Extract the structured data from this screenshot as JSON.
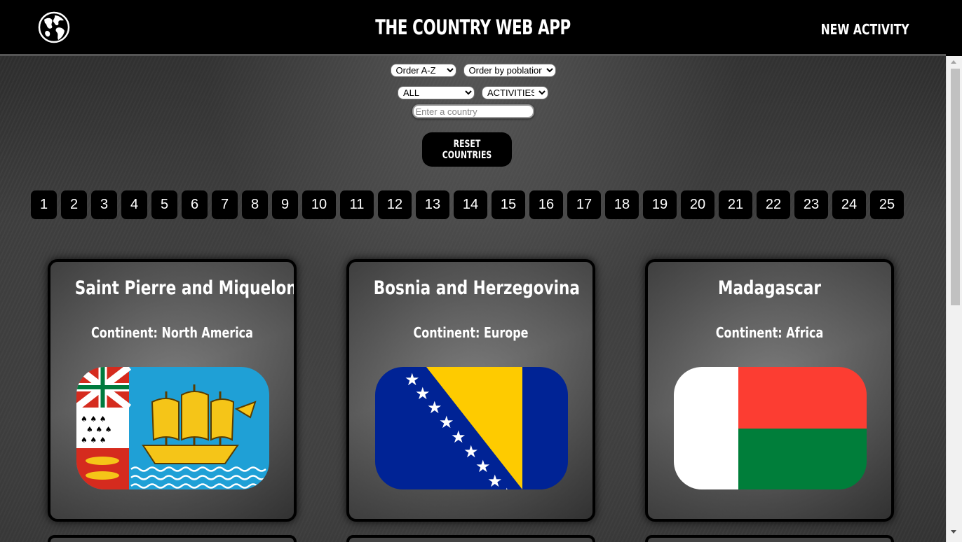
{
  "header": {
    "title": "THE COUNTRY WEB APP",
    "nav_link": "NEW ACTIVITY",
    "logo_icon": "globe-icon"
  },
  "filters": {
    "order_alpha": {
      "selected": "Order A-Z"
    },
    "order_population": {
      "selected": "Order by poblation"
    },
    "continent": {
      "selected": "ALL"
    },
    "activities": {
      "selected": "ACTIVITIES"
    },
    "search": {
      "placeholder": "Enter a country",
      "value": ""
    },
    "reset_label": "RESET COUNTRIES"
  },
  "pagination": {
    "pages": [
      "1",
      "2",
      "3",
      "4",
      "5",
      "6",
      "7",
      "8",
      "9",
      "10",
      "11",
      "12",
      "13",
      "14",
      "15",
      "16",
      "17",
      "18",
      "19",
      "20",
      "21",
      "22",
      "23",
      "24",
      "25"
    ]
  },
  "cards": [
    {
      "name": "Saint Pierre and Miquelon",
      "continent": "Continent: North America",
      "flag": "saint-pierre-and-miquelon-flag"
    },
    {
      "name": "Bosnia and Herzegovina",
      "continent": "Continent: Europe",
      "flag": "bosnia-and-herzegovina-flag"
    },
    {
      "name": "Madagascar",
      "continent": "Continent: Africa",
      "flag": "madagascar-flag"
    }
  ],
  "colors": {
    "header_bg": "#000000",
    "text": "#ffffff",
    "madagascar_red": "#fc3d32",
    "madagascar_green": "#007e3a",
    "bosnia_blue": "#002395",
    "bosnia_yellow": "#fecb00",
    "spm_blue": "#1fa0d6",
    "spm_gold": "#f5c518"
  }
}
